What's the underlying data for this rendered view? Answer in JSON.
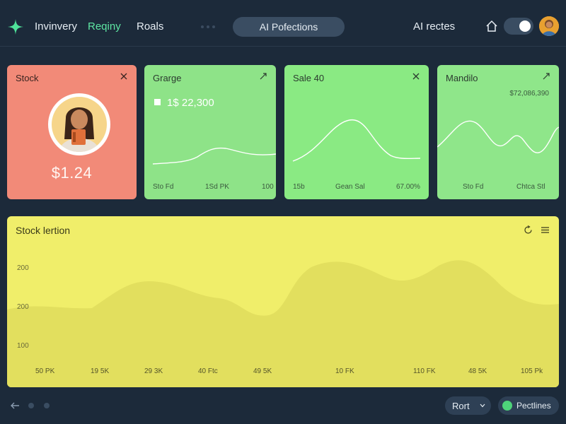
{
  "nav": {
    "items": [
      {
        "label": "Invinvery",
        "active": false
      },
      {
        "label": "Reqiny",
        "active": true
      },
      {
        "label": "Roals",
        "active": false
      }
    ],
    "center_pill": "AI Pofections",
    "right_label": "AI rectes",
    "toggle_on": true
  },
  "cards": {
    "stock": {
      "title": "Stock",
      "price": "$1.24"
    },
    "garage": {
      "title": "Grarge",
      "value": "1$ 22,300",
      "foot_left": "Sto Fd",
      "foot_mid": "1Sd PK",
      "foot_right": "100"
    },
    "sale": {
      "title": "Sale 40",
      "foot_left": "15b",
      "foot_mid": "Gean Sal",
      "foot_right": "67.00%"
    },
    "mandio": {
      "title": "Mandilo",
      "value": "$72,086,390",
      "foot_left": "Sto Fd",
      "foot_right": "Chtca Stl"
    }
  },
  "panel": {
    "title": "Stock lertion",
    "yticks": [
      "200",
      "200",
      "100"
    ],
    "xticks": [
      "50 PK",
      "19 5K",
      "29 3K",
      "40 Ftc",
      "49 5K",
      "10 FK",
      "110 FK",
      "48 5K",
      "105 Pk"
    ]
  },
  "bottom": {
    "sort_label": "Rort",
    "pipelines_label": "Pectlines"
  },
  "colors": {
    "background": "#1c2a3a",
    "accent_green": "#5ee6a3",
    "stock_card": "#f28a78",
    "green_card": "#8ee388",
    "panel": "#f0ee6a"
  }
}
